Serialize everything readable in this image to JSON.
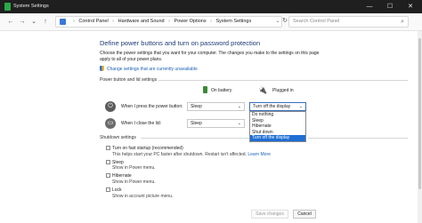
{
  "window": {
    "title": "System Settings",
    "controls": {
      "minimize": "—",
      "maximize": "☐",
      "close": "✕"
    }
  },
  "addressbar": {
    "back": "←",
    "forward": "→",
    "recent": "⌄",
    "up": "↑",
    "breadcrumb": [
      "Control Panel",
      "Hardware and Sound",
      "Power Options",
      "System Settings"
    ],
    "separator": "›",
    "search_placeholder": "Search Control Panel"
  },
  "page": {
    "heading": "Define power buttons and turn on password protection",
    "description": "Choose the power settings that you want for your computer. The changes you make to the settings on this page apply to all of your power plans.",
    "change_link": "Change settings that are currently unavailable"
  },
  "power_section": {
    "label": "Power button and lid settings",
    "col_battery": "On battery",
    "col_plugged": "Plugged in",
    "rows": [
      {
        "label": "When I press the power button:",
        "battery": "Sleep",
        "plugged": "Turn off the display"
      },
      {
        "label": "When I close the lid:",
        "battery": "Sleep",
        "plugged": ""
      }
    ],
    "dropdown_options": [
      "Do nothing",
      "Sleep",
      "Hibernate",
      "Shut down",
      "Turn off the display"
    ],
    "dropdown_selected_index": 4
  },
  "shutdown_section": {
    "label": "Shutdown settings",
    "items": [
      {
        "label": "Turn on fast startup (recommended)",
        "sub": "This helps start your PC faster after shutdown. Restart isn't affected.",
        "link": "Learn More"
      },
      {
        "label": "Sleep",
        "sub": "Show in Power menu."
      },
      {
        "label": "Hibernate",
        "sub": "Show in Power menu."
      },
      {
        "label": "Lock",
        "sub": "Show in account picture menu."
      }
    ]
  },
  "footer": {
    "save": "Save changes",
    "cancel": "Cancel"
  },
  "colors": {
    "accent": "#1f6ed4",
    "heading": "#1e3c78",
    "link": "#1a5fb4",
    "titlebar": "#1f1f1f"
  }
}
